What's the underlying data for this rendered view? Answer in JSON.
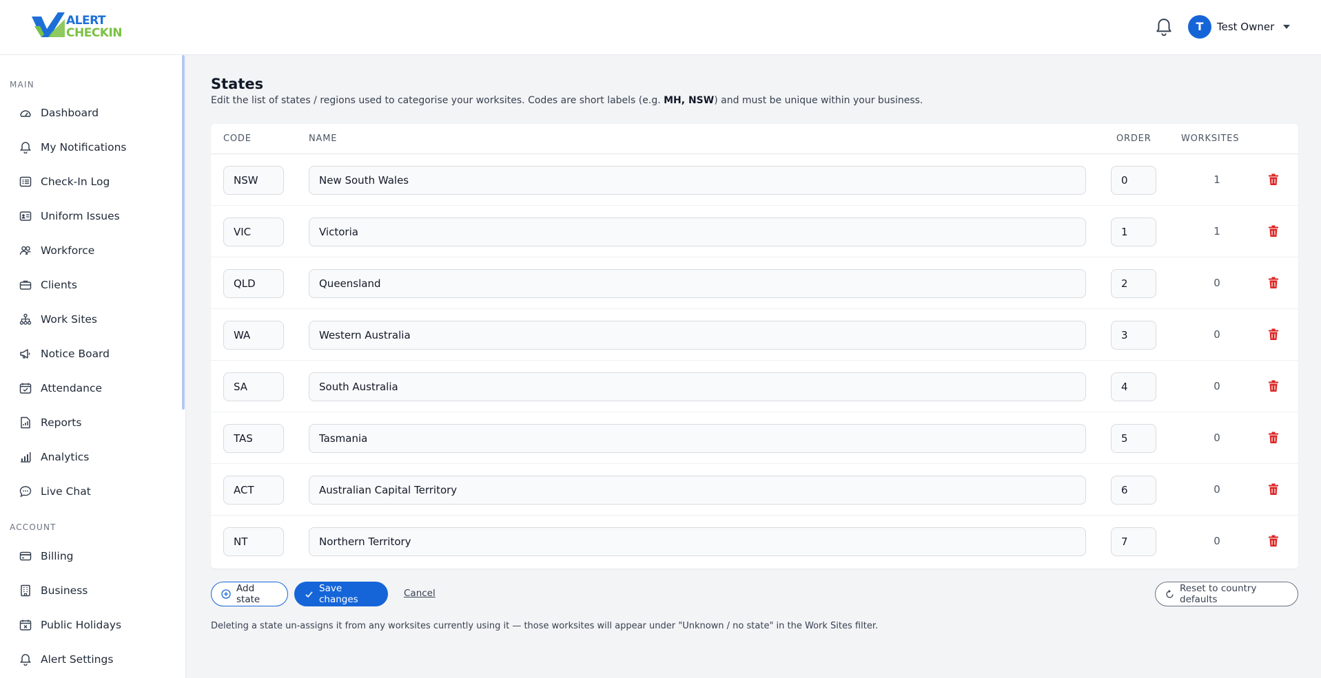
{
  "app": {
    "logo_line1": "ALERT",
    "logo_line2": "CHECKIN",
    "user_initial": "T",
    "user_name": "Test Owner"
  },
  "sidebar": {
    "main_section": "MAIN",
    "account_section": "ACCOUNT",
    "main_items": [
      {
        "label": "Dashboard",
        "icon": "dashboard-icon"
      },
      {
        "label": "My Notifications",
        "icon": "bell-icon"
      },
      {
        "label": "Check-In Log",
        "icon": "list-icon"
      },
      {
        "label": "Uniform Issues",
        "icon": "id-card-icon"
      },
      {
        "label": "Workforce",
        "icon": "users-icon"
      },
      {
        "label": "Clients",
        "icon": "briefcase-icon"
      },
      {
        "label": "Work Sites",
        "icon": "sitemap-icon"
      },
      {
        "label": "Notice Board",
        "icon": "megaphone-icon"
      },
      {
        "label": "Attendance",
        "icon": "calendar-check-icon"
      },
      {
        "label": "Reports",
        "icon": "report-icon"
      },
      {
        "label": "Analytics",
        "icon": "bar-chart-icon"
      },
      {
        "label": "Live Chat",
        "icon": "chat-icon"
      }
    ],
    "account_items": [
      {
        "label": "Billing",
        "icon": "credit-card-icon"
      },
      {
        "label": "Business",
        "icon": "building-icon"
      },
      {
        "label": "Public Holidays",
        "icon": "calendar-x-icon"
      },
      {
        "label": "Alert Settings",
        "icon": "bell-icon"
      }
    ]
  },
  "page": {
    "title": "States",
    "desc_pre": "Edit the list of states / regions used to categorise your worksites. Codes are short labels (e.g. ",
    "desc_bold": "MH, NSW",
    "desc_post": ") and must be unique within your business.",
    "columns": {
      "code": "CODE",
      "name": "NAME",
      "order": "ORDER",
      "worksites": "WORKSITES"
    },
    "rows": [
      {
        "code": "NSW",
        "name": "New South Wales",
        "order": "0",
        "worksites": "1"
      },
      {
        "code": "VIC",
        "name": "Victoria",
        "order": "1",
        "worksites": "1"
      },
      {
        "code": "QLD",
        "name": "Queensland",
        "order": "2",
        "worksites": "0"
      },
      {
        "code": "WA",
        "name": "Western Australia",
        "order": "3",
        "worksites": "0"
      },
      {
        "code": "SA",
        "name": "South Australia",
        "order": "4",
        "worksites": "0"
      },
      {
        "code": "TAS",
        "name": "Tasmania",
        "order": "5",
        "worksites": "0"
      },
      {
        "code": "ACT",
        "name": "Australian Capital Territory",
        "order": "6",
        "worksites": "0"
      },
      {
        "code": "NT",
        "name": "Northern Territory",
        "order": "7",
        "worksites": "0"
      }
    ],
    "actions": {
      "add": "Add state",
      "save": "Save changes",
      "cancel": "Cancel",
      "reset": "Reset to country defaults"
    },
    "footer_note": "Deleting a state un-assigns it from any worksites currently using it — those worksites will appear under \"Unknown / no state\" in the Work Sites filter."
  },
  "colors": {
    "primary": "#1565d8",
    "danger": "#dc2626",
    "logo_blue": "#1d6fd8",
    "logo_green": "#7ac143"
  }
}
